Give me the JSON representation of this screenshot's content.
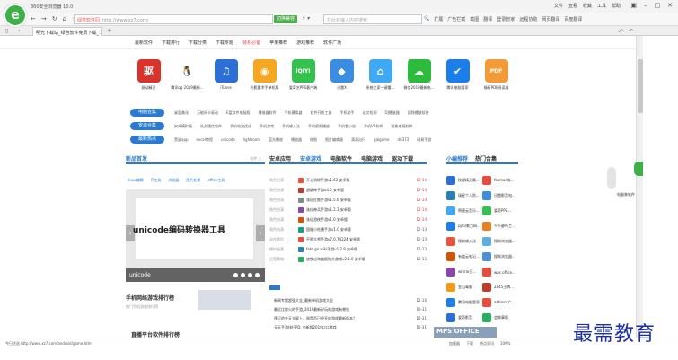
{
  "browser": {
    "title": "360安全浏览器 10.0",
    "menu": [
      "文件",
      "查看",
      "收藏",
      "工具",
      "帮助"
    ],
    "url_tag": "绿茶",
    "url_host": "绿茶软件园",
    "url": "http://www.xz7.com/",
    "green_btn": "切换兼容",
    "search_placeholder": "在此处输入内容搜索",
    "toolbar": [
      "扩展",
      "广告拦截",
      "截图",
      "翻译",
      "登录管家",
      "远程协助",
      "网页翻译",
      "百度翻译"
    ],
    "tab_title": "明光下载站_绿色软件免费下载_...",
    "status_url": "今日优选  http://www.xz7.com/android/game.html",
    "status_tools": [
      "加速器",
      "下载",
      "热点资讯",
      "100%"
    ]
  },
  "site_nav": [
    "最新软件",
    "下载排行",
    "下载分类",
    "下载专题",
    "装机必备",
    "苹果推荐",
    "游戏推荐",
    "软件广场"
  ],
  "site_nav_active": 6,
  "apps": [
    {
      "name": "驱动精灵",
      "color": "#d9342b",
      "glyph": "驱"
    },
    {
      "name": "腾讯qq 2019最新...",
      "color": "#ffffff",
      "glyph": "🐧"
    },
    {
      "name": "iTunes",
      "color": "#2c6fd6",
      "glyph": "♫"
    },
    {
      "name": "光影魔术手单机版",
      "color": "#f5a623",
      "glyph": "◉"
    },
    {
      "name": "爱奇艺PPS客户端",
      "color": "#32c24d",
      "glyph": "iQIYI"
    },
    {
      "name": "迅雷X",
      "color": "#3a8de0",
      "glyph": "◆"
    },
    {
      "name": "系统之家一键重...",
      "color": "#3fa9f5",
      "glyph": "⌂"
    },
    {
      "name": "微信2019最新电...",
      "color": "#2dbb3e",
      "glyph": "☁"
    },
    {
      "name": "腾讯电脑管家",
      "color": "#1c7ee8",
      "glyph": "✔"
    },
    {
      "name": "福昕PDF阅读器",
      "color": "#f39c37",
      "glyph": "PDF"
    }
  ],
  "categories": [
    {
      "label": "电脑合集",
      "links": [
        "桌面美化",
        "万能网卡驱动",
        "E盘软件电脑版",
        "播放器软件",
        "手机模拟器",
        "软件开发工具",
        "手机助手",
        "论文检测",
        "DJ播放器",
        "视频播放软件"
      ]
    },
    {
      "label": "安卓合集",
      "links": [
        "安卓模拟器",
        "社交通信软件",
        "手机电池优化",
        "手机游戏",
        "手机输入法",
        "手机视频播放",
        "手机看小说",
        "手机VR软件",
        "智能电视软件"
      ]
    },
    {
      "label": "最新热点",
      "links": [
        "黑鲨app",
        "excel教程",
        "unicode",
        "lightroom",
        "蓝光播放",
        "播放器",
        "修图",
        "图片编辑器",
        "滴滴出行",
        "galgame",
        "dd373",
        "网易手游"
      ]
    }
  ],
  "new_section": {
    "title": "新品首发",
    "pager": "软件 >",
    "subtabs": [
      "linux编辑",
      "IT工具",
      "浏览器",
      "图片处理",
      "office工具"
    ],
    "slide_title": "unicode编码转换器工具",
    "slide_caption": "unicode",
    "game_title": "手机网络游戏排行榜",
    "game_sub": "热门手机游戏排行榜",
    "rank_title": "直播平台软件排行榜"
  },
  "list_section": {
    "tabs": [
      "安卓应用",
      "安卓游戏",
      "电脑软件",
      "电脑游戏",
      "驱动下载"
    ],
    "active": 1,
    "items": [
      {
        "cat": "角色扮演",
        "name": "开心消除手游v1.62 安卓版",
        "date": "12-14",
        "red": true,
        "color": "#e8553d"
      },
      {
        "cat": "角色扮演",
        "name": "超级神手游v4.0 安卓版",
        "date": "12-14",
        "red": true,
        "color": "#c0392b"
      },
      {
        "cat": "角色扮演",
        "name": "诛仙红颜手游v1.5.6 安卓版",
        "date": "12-14",
        "red": true,
        "color": "#7f8c8d"
      },
      {
        "cat": "角色扮演",
        "name": "诛仙神兵手游v1.2.3 安卓版",
        "date": "12-14",
        "red": true,
        "color": "#8e44ad"
      },
      {
        "cat": "角色扮演",
        "name": "诛仙游侠手游v1.0 安卓版",
        "date": "12-14",
        "red": true,
        "color": "#d35400"
      },
      {
        "cat": "角色扮演",
        "name": "国服小吃播手游v1.0 安卓版",
        "date": "12-13",
        "red": false,
        "color": "#16a085"
      },
      {
        "cat": "动作冒险",
        "name": "不败大师手游v7.0.74224 安卓版",
        "date": "12-13",
        "red": false,
        "color": "#e74c3c"
      },
      {
        "cat": "模拟经营",
        "name": "fate go wiki手游v1.2.8 安卓版",
        "date": "12-13",
        "red": false,
        "color": "#2980b9"
      },
      {
        "cat": "经营策略",
        "name": "放牧过海盗贩购大游戏v2.1.0 安卓版",
        "date": "12-13",
        "red": false,
        "color": "#27ae60"
      }
    ],
    "news": [
      {
        "name": "新闻专题超强大全_最新单机游戏大全",
        "date": "12-10"
      },
      {
        "name": "最近比较火的手游_2019最新好玩的游戏有哪些",
        "date": "10-31"
      },
      {
        "name": "预订的今天大屏上，闻是否已经开放游戏最新版本？",
        "date": "10-31"
      },
      {
        "name": "天天手游排行PD_全新版2019口口游戏",
        "date": "10-31"
      }
    ]
  },
  "rec_section": {
    "tabs": [
      "小编推荐",
      "热门合集"
    ],
    "items": [
      {
        "name": "按键精灵最...",
        "color": "#2c6fd6"
      },
      {
        "name": "foxmail电...",
        "color": "#e74c3c"
      },
      {
        "name": "瑞星个人防...",
        "color": "#2980b9"
      },
      {
        "name": "迅雷影音电...",
        "color": "#3a8de0"
      },
      {
        "name": "啊速云音乐...",
        "color": "#3fa9f5"
      },
      {
        "name": "爱奇PPS...",
        "color": "#32c24d"
      },
      {
        "name": "pptv聚力网...",
        "color": "#1c7ee8"
      },
      {
        "name": "千千静听工...",
        "color": "#e67e22"
      },
      {
        "name": "搜狗输入法",
        "color": "#e8553d"
      },
      {
        "name": "搜狗浏览器...",
        "color": "#5dade2"
      },
      {
        "name": "有道云笔记...",
        "color": "#d35400"
      },
      {
        "name": "搜狗浏览器...",
        "color": "#4a90d9"
      },
      {
        "name": "winrar压...",
        "color": "#8e44ad"
      },
      {
        "name": "wps office...",
        "color": "#e74c3c"
      },
      {
        "name": "金山毒霸",
        "color": "#f39c12"
      },
      {
        "name": "2345王牌...",
        "color": "#c0392b"
      },
      {
        "name": "腾讯电脑管家",
        "color": "#1c7ee8"
      },
      {
        "name": "adblock广...",
        "color": "#e74c3c"
      },
      {
        "name": "爱奇影音",
        "color": "#2c6fd6"
      },
      {
        "name": "会做事版",
        "color": "#27ae60"
      }
    ]
  },
  "ad_label": "MPS OFFICE",
  "float_text": "电脑装软件",
  "watermark": "最需教育"
}
